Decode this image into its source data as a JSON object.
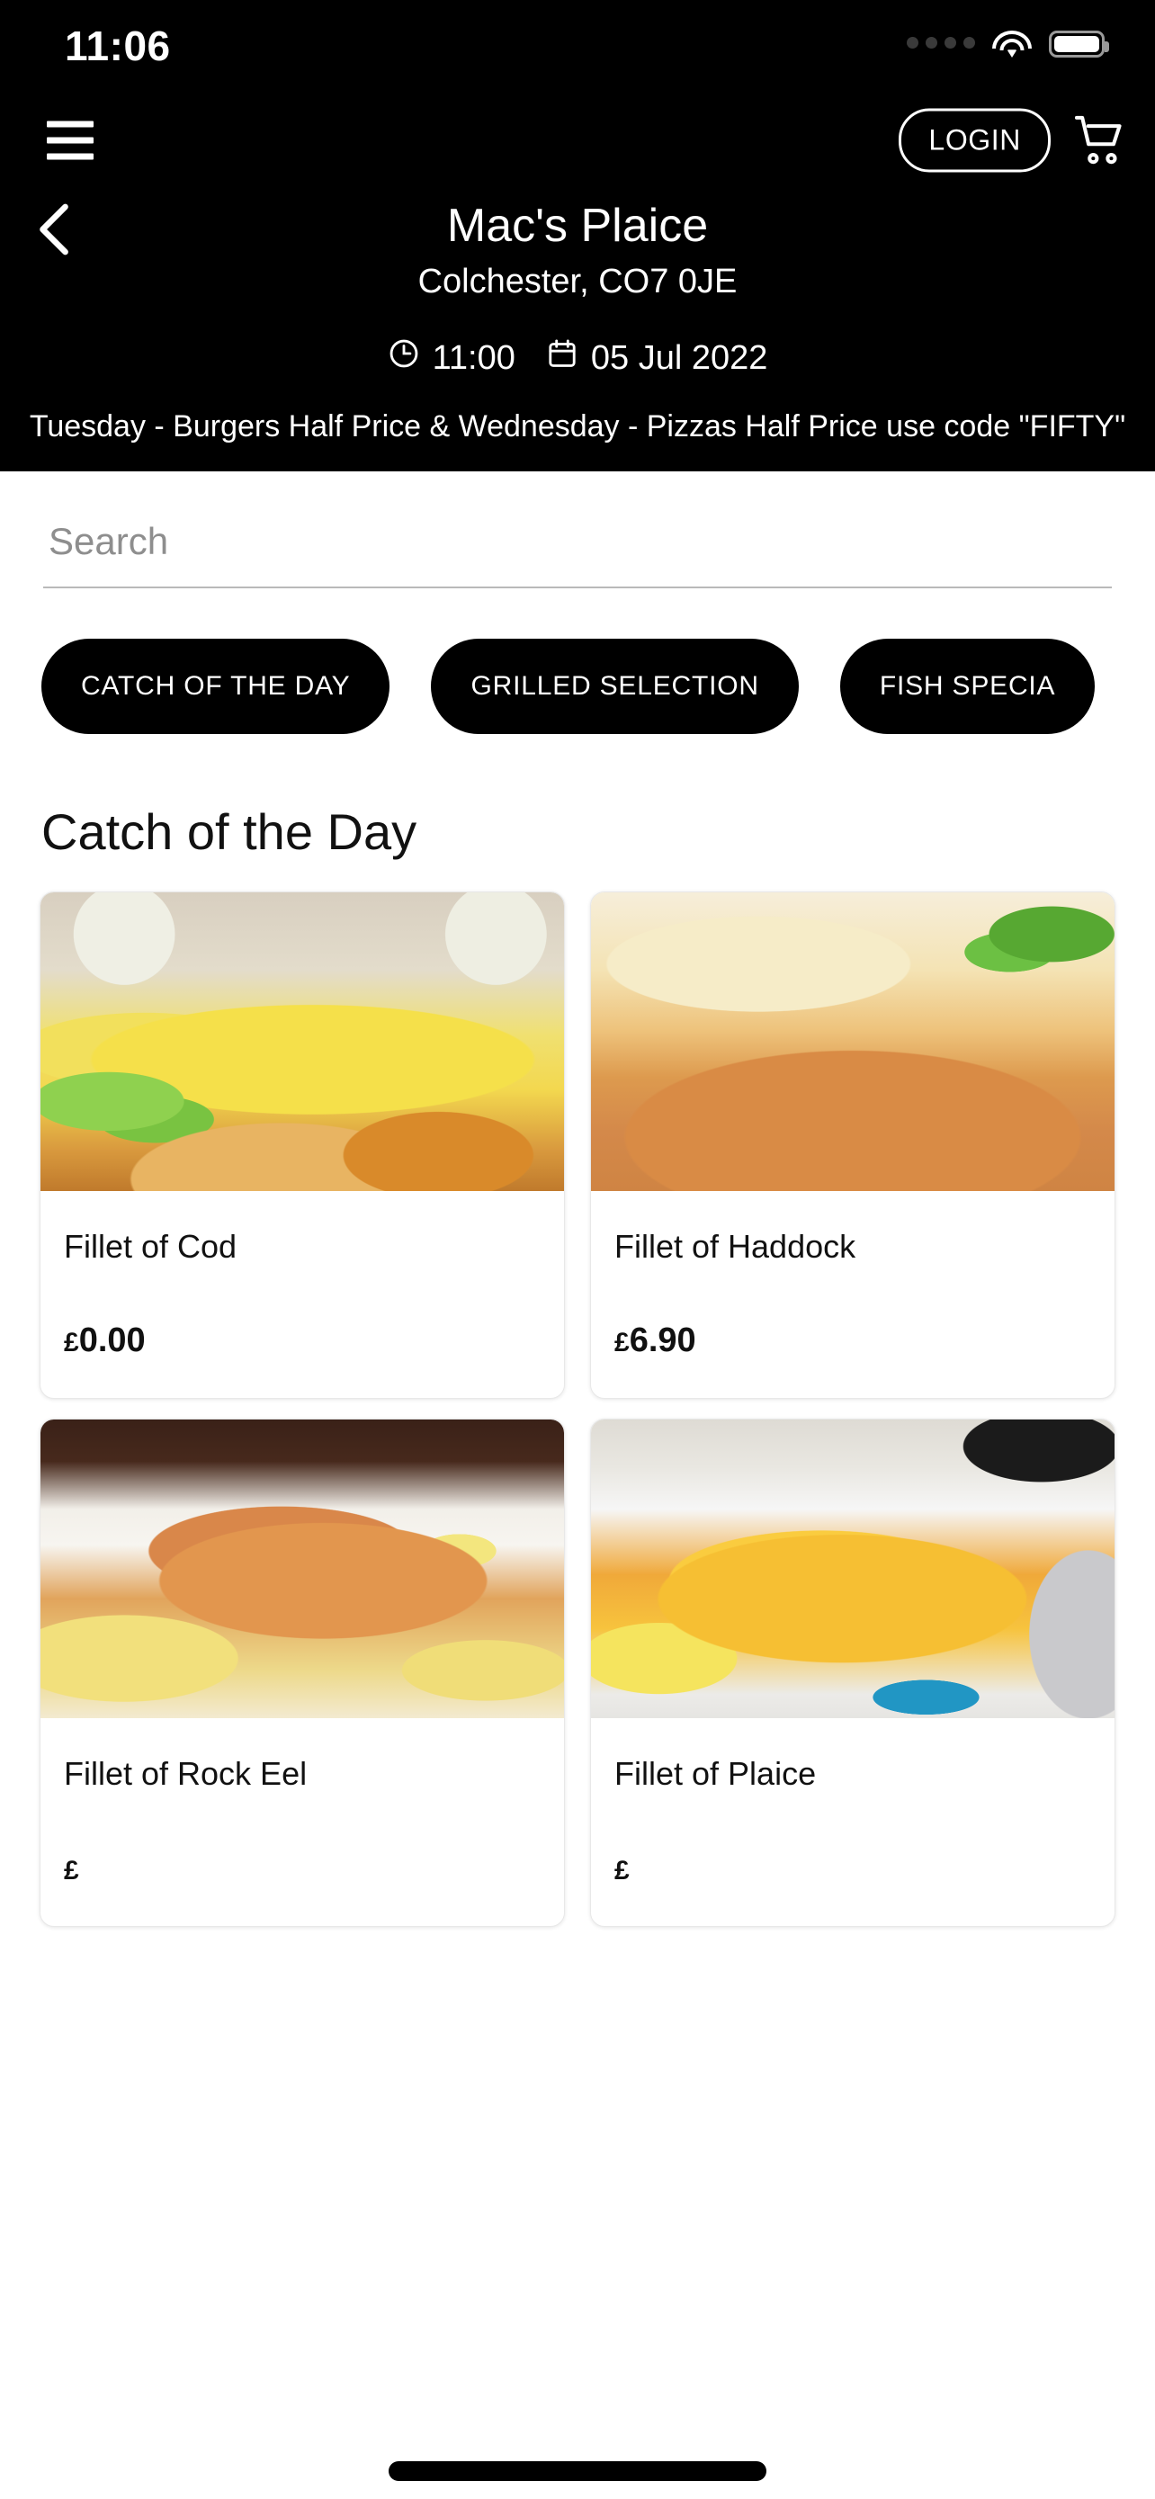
{
  "status_bar": {
    "time": "11:06",
    "signal_icon": "signal-dots-icon",
    "wifi_icon": "wifi-icon",
    "battery_icon": "battery-full-icon"
  },
  "nav": {
    "menu_icon": "hamburger-menu-icon",
    "login_label": "LOGIN",
    "cart_icon": "shopping-cart-icon",
    "back_icon": "back-chevron-icon"
  },
  "shop": {
    "name": "Mac's Plaice",
    "address": "Colchester, CO7 0JE",
    "time_icon": "clock-icon",
    "time": "11:00",
    "date_icon": "calendar-icon",
    "date": "05 Jul 2022",
    "promo": "Tuesday - Burgers Half Price & Wednesday - Pizzas Half Price use code \"FIFTY\""
  },
  "search": {
    "placeholder": "Search",
    "value": ""
  },
  "categories": [
    {
      "label": "CATCH OF THE DAY",
      "active": true
    },
    {
      "label": "GRILLED SELECTION",
      "active": false
    },
    {
      "label": "FISH SPECIA",
      "active": false
    }
  ],
  "section": {
    "title": "Catch of the Day"
  },
  "products": [
    {
      "name": "Fillet of Cod",
      "currency": "£",
      "price": "0.00",
      "image": "fish-chips-mushy-peas-photo"
    },
    {
      "name": "Fillet of Haddock",
      "currency": "£",
      "price": "6.90",
      "image": "battered-haddock-photo"
    },
    {
      "name": "Fillet of Rock Eel",
      "currency": "£",
      "price": "",
      "image": "rock-eel-plate-photo"
    },
    {
      "name": "Fillet of Plaice",
      "currency": "£",
      "price": "",
      "image": "plaice-fillet-plate-photo"
    }
  ],
  "colors": {
    "header_background": "#000000",
    "page_background": "#ffffff",
    "chip_background": "#000000",
    "chip_text": "#ffffff",
    "text_primary": "#111111",
    "placeholder": "#8e8e8e"
  }
}
